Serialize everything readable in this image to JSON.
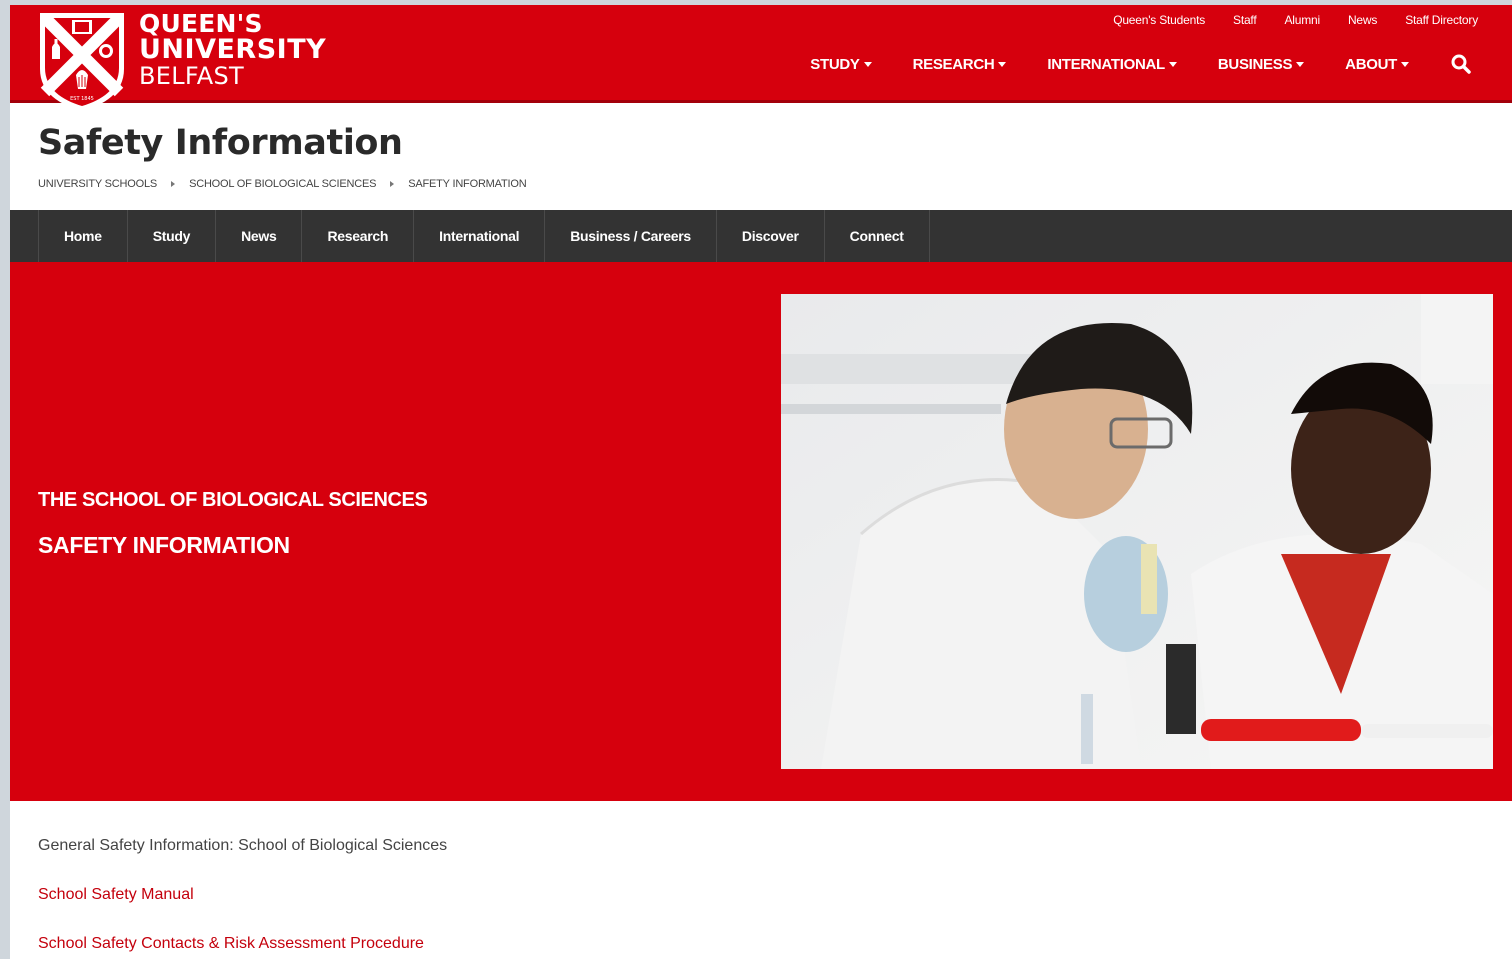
{
  "brand": {
    "line1": "QUEEN'S",
    "line2": "UNIVERSITY",
    "line3": "BELFAST",
    "crest_text": "EST 1845"
  },
  "utility_links": [
    "Queen's Students",
    "Staff",
    "Alumni",
    "News",
    "Staff Directory"
  ],
  "main_nav": [
    "STUDY",
    "RESEARCH",
    "INTERNATIONAL",
    "BUSINESS",
    "ABOUT"
  ],
  "page": {
    "title": "Safety Information",
    "breadcrumb": [
      "UNIVERSITY SCHOOLS",
      "SCHOOL OF BIOLOGICAL SCIENCES",
      "SAFETY INFORMATION"
    ]
  },
  "section_nav": [
    "Home",
    "Study",
    "News",
    "Research",
    "International",
    "Business / Careers",
    "Discover",
    "Connect"
  ],
  "hero": {
    "kicker": "THE SCHOOL OF BIOLOGICAL SCIENCES",
    "subtitle": "SAFETY INFORMATION"
  },
  "content": {
    "intro": "General Safety Information: School of Biological Sciences",
    "links": [
      "School Safety Manual",
      "School Safety Contacts & Risk Assessment Procedure"
    ]
  },
  "colors": {
    "brand_red": "#d6000d",
    "nav_dark": "#333333",
    "link_red": "#c4000c"
  },
  "icons": [
    "crest-logo",
    "search-icon",
    "caret-down-icon",
    "breadcrumb-arrow-icon"
  ]
}
